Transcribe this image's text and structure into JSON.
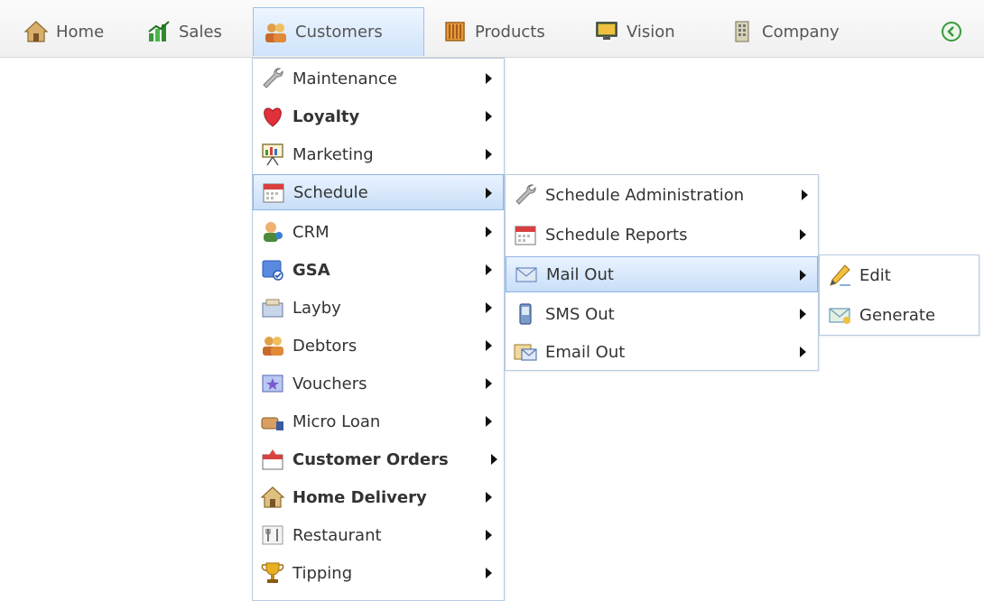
{
  "nav": {
    "items": [
      {
        "label": "Home",
        "icon": "home-icon"
      },
      {
        "label": "Sales",
        "icon": "sales-chart-icon"
      },
      {
        "label": "Customers",
        "icon": "customers-icon"
      },
      {
        "label": "Products",
        "icon": "products-icon"
      },
      {
        "label": "Vision",
        "icon": "vision-monitor-icon"
      },
      {
        "label": "Company",
        "icon": "company-building-icon"
      }
    ],
    "active": "Customers"
  },
  "customers_menu": {
    "items": [
      {
        "label": "Maintenance",
        "icon": "wrench-icon"
      },
      {
        "label": "Loyalty",
        "icon": "heart-icon"
      },
      {
        "label": "Marketing",
        "icon": "presentation-board-icon"
      },
      {
        "label": "Schedule",
        "icon": "calendar-icon"
      },
      {
        "label": "CRM",
        "icon": "crm-person-icon"
      },
      {
        "label": "GSA",
        "icon": "gsa-card-icon"
      },
      {
        "label": "Layby",
        "icon": "layby-icon"
      },
      {
        "label": "Debtors",
        "icon": "debtors-people-icon"
      },
      {
        "label": "Vouchers",
        "icon": "voucher-icon"
      },
      {
        "label": "Micro Loan",
        "icon": "micro-loan-icon"
      },
      {
        "label": "Customer Orders",
        "icon": "customer-orders-icon"
      },
      {
        "label": "Home Delivery",
        "icon": "home-delivery-icon"
      },
      {
        "label": "Restaurant",
        "icon": "restaurant-icon"
      },
      {
        "label": "Tipping",
        "icon": "trophy-icon"
      }
    ]
  },
  "schedule_menu": {
    "items": [
      {
        "label": "Schedule Administration",
        "icon": "wrench-icon"
      },
      {
        "label": "Schedule Reports",
        "icon": "calendar-icon"
      },
      {
        "label": "Mail Out",
        "icon": "envelope-icon"
      },
      {
        "label": "SMS Out",
        "icon": "phone-icon"
      },
      {
        "label": "Email Out",
        "icon": "email-icon"
      }
    ]
  },
  "mailout_menu": {
    "items": [
      {
        "label": "Edit",
        "icon": "pencil-icon"
      },
      {
        "label": "Generate",
        "icon": "envelope-icon"
      }
    ]
  }
}
